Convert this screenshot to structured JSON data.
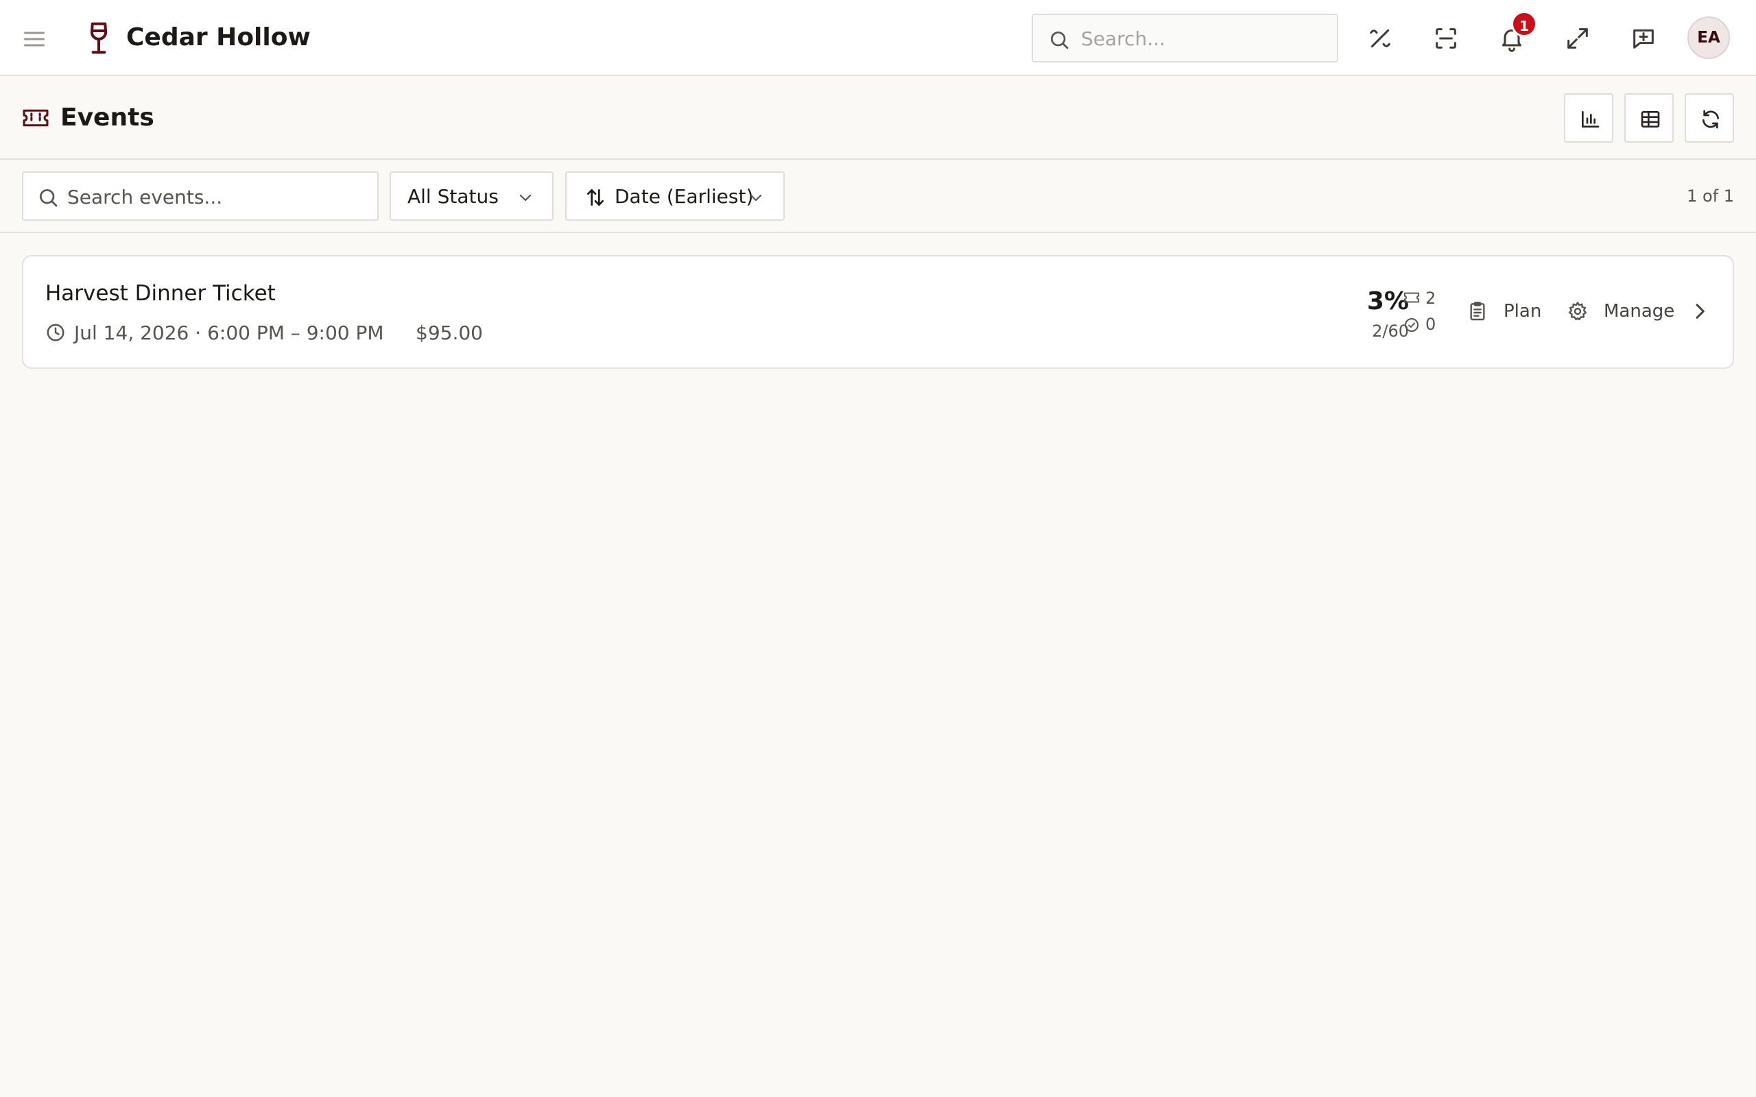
{
  "app": {
    "brand_name": "Cedar Hollow",
    "search_placeholder": "Search...",
    "notification_count": "1",
    "user_initials": "EA"
  },
  "page": {
    "title": "Events"
  },
  "filters": {
    "search_placeholder": "Search events...",
    "status_selected": "All Status",
    "sort_selected": "Date (Earliest)",
    "pagination": "1 of 1"
  },
  "events": [
    {
      "title": "Harvest Dinner Ticket",
      "datetime": "Jul 14, 2026 · 6:00 PM – 9:00 PM",
      "price": "$95.00",
      "fill_percent": "3%",
      "sold_ratio": "2/60",
      "tickets_count": "2",
      "checked_in_count": "0",
      "plan_label": "Plan",
      "manage_label": "Manage"
    }
  ],
  "icons": {
    "brand": "wine-glass-icon",
    "menu": "hamburger-menu-icon",
    "toolbar": [
      "percent-tag-icon",
      "scan-icon",
      "bell-icon",
      "expand-icon",
      "feedback-icon"
    ],
    "header_actions": [
      "bar-chart-icon",
      "table-icon",
      "refresh-icon"
    ]
  },
  "colors": {
    "accent": "#5c0f14",
    "badge": "#c8101a",
    "background": "#faf9f6"
  }
}
